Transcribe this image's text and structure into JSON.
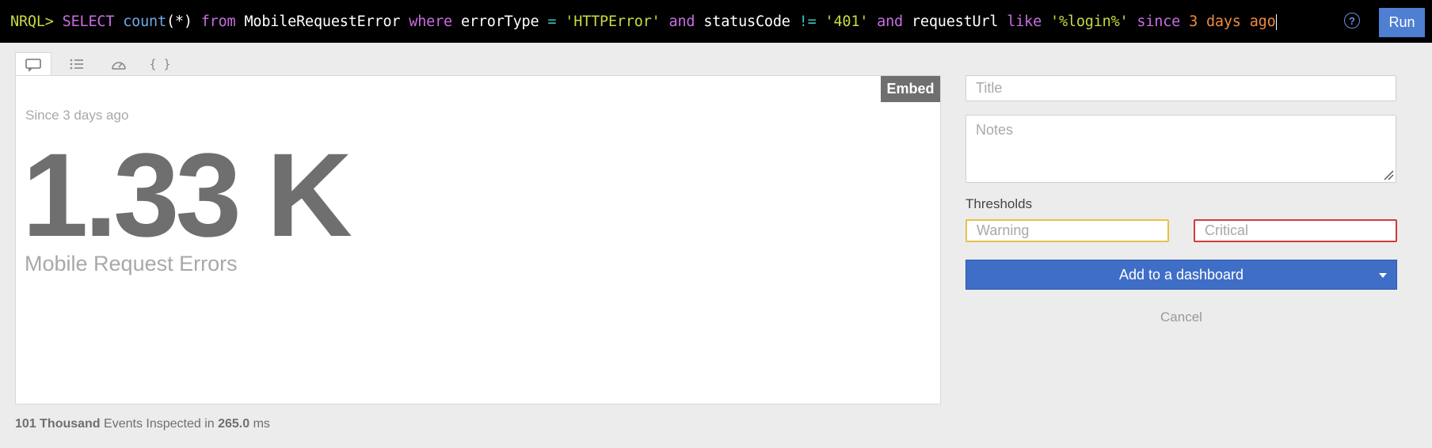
{
  "query": {
    "prompt": "NRQL>",
    "tokens": [
      {
        "text": "SELECT",
        "kind": "kw"
      },
      {
        "text": "count",
        "kind": "fn"
      },
      {
        "text": "(*)",
        "kind": "id"
      },
      {
        "text": "from",
        "kind": "kw"
      },
      {
        "text": "MobileRequestError",
        "kind": "id"
      },
      {
        "text": "where",
        "kind": "kw"
      },
      {
        "text": "errorType",
        "kind": "id"
      },
      {
        "text": "=",
        "kind": "op"
      },
      {
        "text": "'HTTPError'",
        "kind": "str"
      },
      {
        "text": "and",
        "kind": "kw"
      },
      {
        "text": "statusCode",
        "kind": "id"
      },
      {
        "text": "!=",
        "kind": "op"
      },
      {
        "text": "'401'",
        "kind": "str"
      },
      {
        "text": "and",
        "kind": "kw"
      },
      {
        "text": "requestUrl",
        "kind": "id"
      },
      {
        "text": "like",
        "kind": "kw"
      },
      {
        "text": "'%login%'",
        "kind": "str"
      },
      {
        "text": "since",
        "kind": "kw"
      },
      {
        "text": "3",
        "kind": "num"
      },
      {
        "text": "days",
        "kind": "num"
      },
      {
        "text": "ago",
        "kind": "num"
      }
    ],
    "run_label": "Run",
    "help_icon": "?"
  },
  "tabs": [
    {
      "icon": "billboard-icon",
      "active": true
    },
    {
      "icon": "list-icon",
      "active": false
    },
    {
      "icon": "gauge-icon",
      "active": false
    },
    {
      "icon": "json-icon",
      "active": false,
      "glyph": "{ }"
    }
  ],
  "panel": {
    "embed_label": "Embed",
    "since_text": "Since 3 days ago",
    "value": "1.33 K",
    "label": "Mobile Request Errors"
  },
  "footer": {
    "events_count": "101 Thousand",
    "events_text": " Events Inspected in ",
    "duration": "265.0",
    "duration_unit": " ms"
  },
  "form": {
    "title_placeholder": "Title",
    "notes_placeholder": "Notes",
    "thresholds_label": "Thresholds",
    "warning_placeholder": "Warning",
    "critical_placeholder": "Critical",
    "add_label": "Add to a dashboard",
    "cancel_label": "Cancel"
  },
  "colors": {
    "run_button": "#4f7fd2",
    "add_button": "#3f6ec6",
    "warning_border": "#e7c04a",
    "critical_border": "#d23a3a"
  }
}
